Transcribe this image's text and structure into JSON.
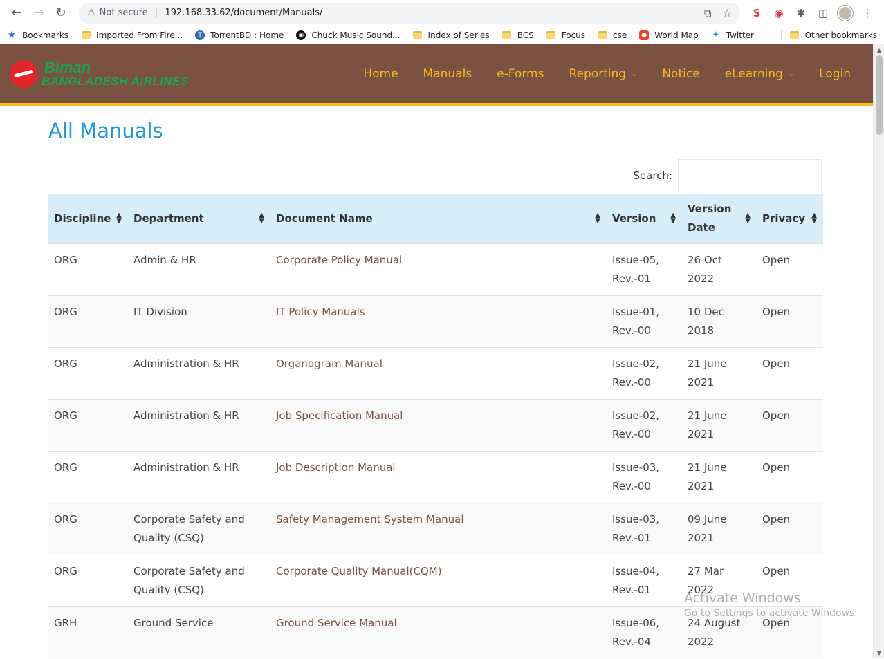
{
  "browser": {
    "security": "Not secure",
    "url": "192.168.33.62/document/Manuals/",
    "bookmarks": [
      {
        "label": "Bookmarks",
        "icon": "star-icon"
      },
      {
        "label": "Imported From Fire...",
        "icon": "folder-icon"
      },
      {
        "label": "TorrentBD : Home",
        "icon": "torrentbd-icon"
      },
      {
        "label": "Chuck Music Sound...",
        "icon": "music-icon"
      },
      {
        "label": "Index of Series",
        "icon": "folder-icon"
      },
      {
        "label": "BCS",
        "icon": "folder-icon"
      },
      {
        "label": "Focus",
        "icon": "folder-icon"
      },
      {
        "label": "cse",
        "icon": "folder-icon"
      },
      {
        "label": "World Map",
        "icon": "map-pin-icon"
      },
      {
        "label": "Twitter",
        "icon": "twitter-icon"
      }
    ],
    "other_bookmarks": "Other bookmarks"
  },
  "site": {
    "logo_line1": "Biman",
    "logo_line2": "BANGLADESH AIRLINES",
    "nav": {
      "home": "Home",
      "manuals": "Manuals",
      "eforms": "e-Forms",
      "reporting": "Reporting",
      "notice": "Notice",
      "elearning": "eLearning",
      "login": "Login"
    }
  },
  "page": {
    "title": "All Manuals",
    "search_label": "Search:"
  },
  "table": {
    "headers": {
      "discipline": "Discipline",
      "department": "Department",
      "document_name": "Document Name",
      "version": "Version",
      "version_date_1": "Version",
      "version_date_2": "Date",
      "privacy": "Privacy"
    },
    "rows": [
      {
        "discipline": "ORG",
        "department": "Admin & HR",
        "document": "Corporate Policy Manual",
        "version_1": "Issue-05,",
        "version_2": "Rev.-01",
        "date": "26 Oct 2022",
        "privacy": "Open"
      },
      {
        "discipline": "ORG",
        "department": "IT Division",
        "document": "IT Policy Manuals",
        "version_1": "Issue-01,",
        "version_2": "Rev.-00",
        "date": "10 Dec 2018",
        "privacy": "Open"
      },
      {
        "discipline": "ORG",
        "department": "Administration & HR",
        "document": "Organogram Manual",
        "version_1": "Issue-02,",
        "version_2": "Rev.-00",
        "date": "21 June 2021",
        "privacy": "Open"
      },
      {
        "discipline": "ORG",
        "department": "Administration & HR",
        "document": "Job Specification Manual",
        "version_1": "Issue-02,",
        "version_2": "Rev.-00",
        "date": "21 June 2021",
        "privacy": "Open"
      },
      {
        "discipline": "ORG",
        "department": "Administration & HR",
        "document": "Job Description Manual",
        "version_1": "Issue-03,",
        "version_2": "Rev.-00",
        "date": "21 June 2021",
        "privacy": "Open"
      },
      {
        "discipline": "ORG",
        "department": "Corporate Safety and Quality (CSQ)",
        "document": "Safety Management System Manual",
        "version_1": "Issue-03,",
        "version_2": "Rev.-01",
        "date": "09 June 2021",
        "privacy": "Open"
      },
      {
        "discipline": "ORG",
        "department": "Corporate Safety and Quality (CSQ)",
        "document": "Corporate Quality Manual(CQM)",
        "version_1": "Issue-04,",
        "version_2": "Rev.-01",
        "date": "27 Mar 2022",
        "privacy": "Open"
      },
      {
        "discipline": "GRH",
        "department": "Ground Service",
        "document": "Ground Service Manual",
        "version_1": "Issue-06,",
        "version_2": "Rev.-04",
        "date": "24 August 2022",
        "privacy": "Open"
      }
    ]
  },
  "watermark": {
    "line1": "Activate Windows",
    "line2": "Go to Settings to activate Windows."
  },
  "colors": {
    "header_bg": "#7b5241",
    "header_border": "#f4bd1c",
    "nav_text": "#f6b924",
    "title": "#1f9ad6",
    "table_head": "#d7edf8",
    "link": "#7b5241"
  }
}
